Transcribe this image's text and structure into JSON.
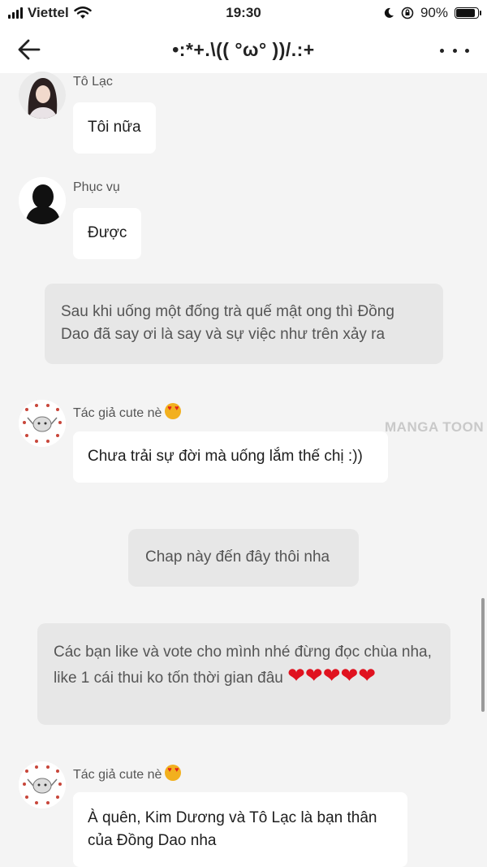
{
  "status_bar": {
    "carrier": "Viettel",
    "time": "19:30",
    "battery_text": "90%",
    "battery_level": 0.9
  },
  "header": {
    "title": "•:*+.\\(( °ω° ))/.:+"
  },
  "messages": [
    {
      "sender": "Tô Lạc",
      "text": "Tôi nữa"
    },
    {
      "sender": "Phục vụ",
      "text": "Được"
    },
    {
      "narration": "Sau khi uống một đống trà quế mật ong thì Đồng Dao đã say ơi là say và sự việc như trên xảy ra"
    },
    {
      "sender": "Tác giả cute nè",
      "text": "Chưa trải sự đời mà uống lắm thế chị :))"
    },
    {
      "narration": "Chap này đến đây thôi nha"
    },
    {
      "narration": "Các bạn like và vote cho mình nhé đừng đọc chùa nha, like 1 cái thui ko tốn thời gian đâu",
      "hearts": "❤❤❤❤❤"
    },
    {
      "sender": "Tác giả cute nè",
      "text": "À quên, Kim Dương và Tô Lạc là bạn thân của Đồng Dao nha"
    }
  ],
  "watermark": "MANGA TOON",
  "colors": {
    "background": "#f4f4f4",
    "bubble": "#ffffff",
    "narration": "#e7e7e7",
    "heart": "#e0121f"
  },
  "icons": [
    "signal-icon",
    "wifi-icon",
    "moon-icon",
    "rotation-lock-icon",
    "battery-icon",
    "back-arrow-icon",
    "more-icon",
    "heart-eyes-emoji-icon",
    "heart-icon"
  ]
}
